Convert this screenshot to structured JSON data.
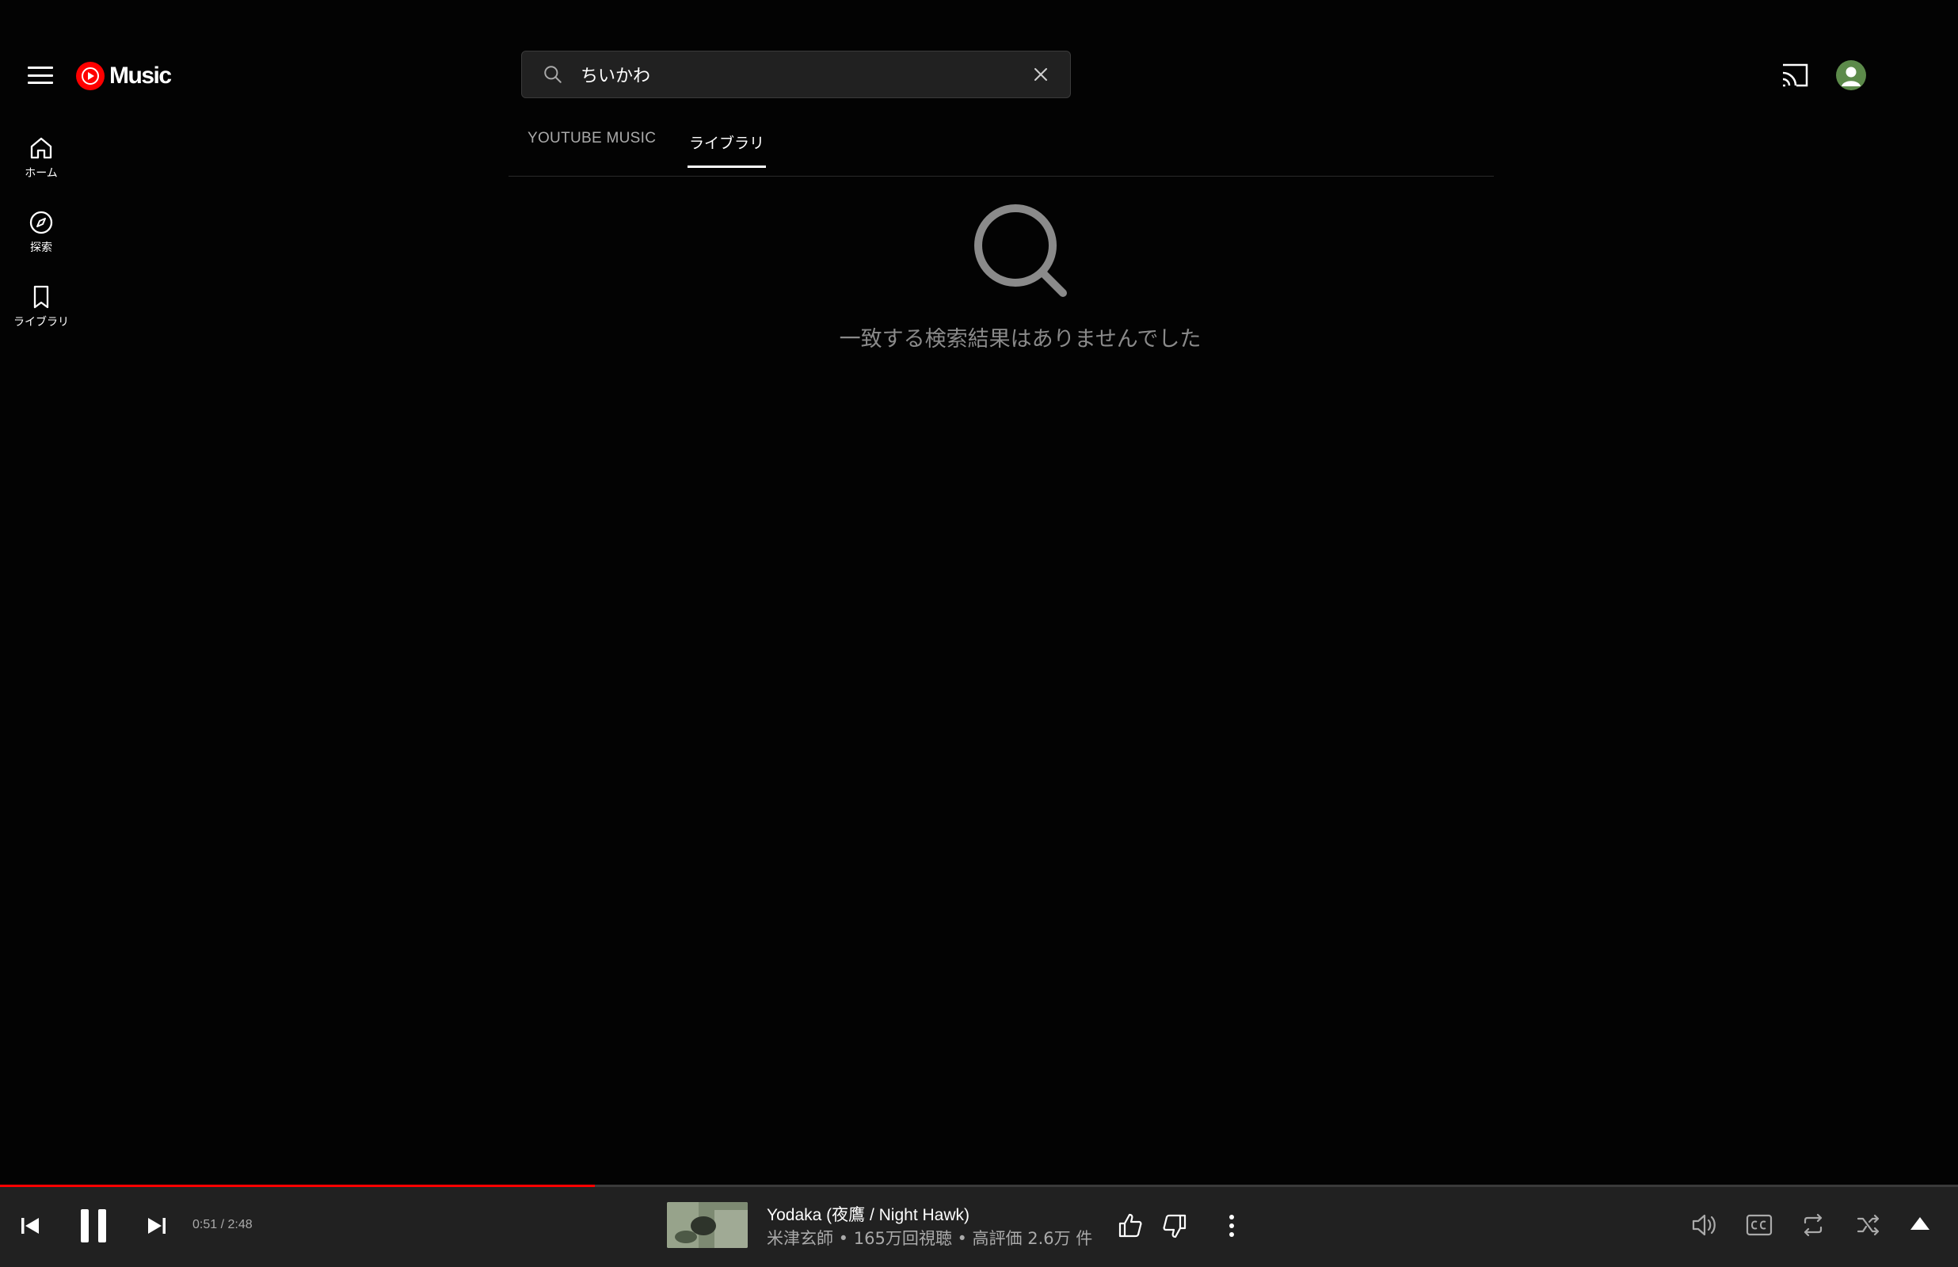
{
  "header": {
    "logo_text": "Music",
    "search_value": "ちいかわ"
  },
  "sidebar": {
    "items": [
      {
        "label": "ホーム",
        "icon": "home-icon"
      },
      {
        "label": "探索",
        "icon": "compass-icon"
      },
      {
        "label": "ライブラリ",
        "icon": "bookmark-icon"
      }
    ]
  },
  "tabs": [
    {
      "label": "YOUTUBE MUSIC",
      "active": false
    },
    {
      "label": "ライブラリ",
      "active": true
    }
  ],
  "empty_state": {
    "message": "一致する検索結果はありませんでした",
    "icon": "search-icon"
  },
  "player": {
    "time": "0:51 / 2:48",
    "progress_fraction": 0.304,
    "track_title": "Yodaka (夜鷹 / Night Hawk)",
    "track_subtitle": "米津玄師 • 165万回視聴 • 高評価 2.6万 件"
  },
  "colors": {
    "background": "#030303",
    "player_bar": "#212121",
    "accent": "#ff0000",
    "avatar": "#5c8a4a"
  }
}
